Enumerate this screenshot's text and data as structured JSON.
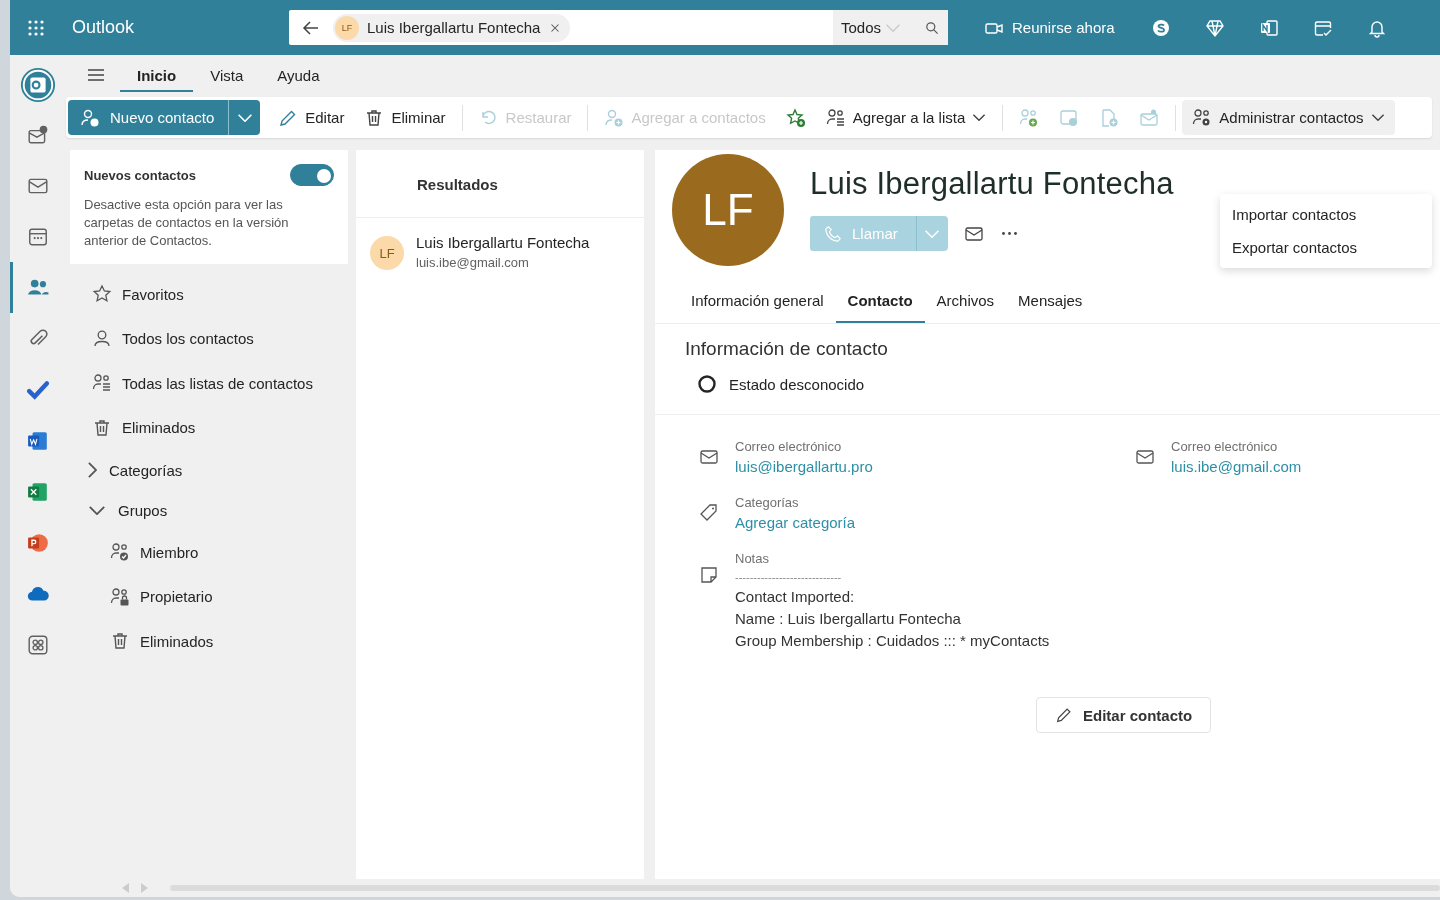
{
  "app": {
    "title": "Outlook"
  },
  "search": {
    "chip": {
      "initials": "LF",
      "label": "Luis Ibergallartu Fontecha"
    },
    "scope": "Todos"
  },
  "header_actions": [
    {
      "kind": "video",
      "label": "Reunirse ahora"
    },
    {
      "kind": "skype"
    },
    {
      "kind": "diamond"
    },
    {
      "kind": "onenote"
    },
    {
      "kind": "calendar-check"
    },
    {
      "kind": "bell"
    }
  ],
  "rail": [
    {
      "kind": "outlook",
      "selected": false
    },
    {
      "kind": "mail-add",
      "selected": false
    },
    {
      "kind": "mail",
      "selected": false
    },
    {
      "kind": "calendar",
      "selected": false
    },
    {
      "kind": "people",
      "selected": true
    },
    {
      "kind": "attach",
      "selected": false
    },
    {
      "kind": "todo",
      "selected": false
    },
    {
      "kind": "word",
      "selected": false
    },
    {
      "kind": "excel",
      "selected": false
    },
    {
      "kind": "powerpoint",
      "selected": false
    },
    {
      "kind": "onedrive",
      "selected": false
    },
    {
      "kind": "apps",
      "selected": false
    }
  ],
  "ribbon_tabs": [
    {
      "label": "Inicio",
      "selected": true
    },
    {
      "label": "Vista",
      "selected": false
    },
    {
      "label": "Ayuda",
      "selected": false
    }
  ],
  "toolbar": [
    {
      "kind": "new",
      "label": "Nuevo contacto",
      "disabled": false
    },
    {
      "kind": "edit",
      "label": "Editar",
      "disabled": false
    },
    {
      "kind": "delete",
      "label": "Eliminar",
      "disabled": false
    },
    {
      "kind": "restore",
      "label": "Restaurar",
      "disabled": true
    },
    {
      "kind": "add-contact",
      "label": "Agregar a contactos",
      "disabled": true
    },
    {
      "kind": "favorite",
      "disabled": false
    },
    {
      "kind": "add-list",
      "label": "Agregar a la lista",
      "disabled": false
    },
    {
      "kind": "add-people",
      "disabled": true
    },
    {
      "kind": "chat",
      "disabled": true
    },
    {
      "kind": "file-add",
      "disabled": true
    },
    {
      "kind": "mail-bell",
      "disabled": true
    },
    {
      "kind": "manage",
      "label": "Administrar contactos",
      "disabled": false
    }
  ],
  "manage_menu": [
    "Importar contactos",
    "Exportar contactos"
  ],
  "new_contacts_card": {
    "title": "Nuevos contactos",
    "on": true,
    "text": "Desactive esta opción para ver las carpetas de contactos en la versión anterior de Contactos."
  },
  "nav": [
    {
      "kind": "favorites",
      "label": "Favoritos"
    },
    {
      "kind": "all",
      "label": "Todos los contactos"
    },
    {
      "kind": "lists",
      "label": "Todas las listas de contactos"
    },
    {
      "kind": "deleted",
      "label": "Eliminados"
    },
    {
      "kind": "group",
      "label": "Categorías",
      "expanded": false
    },
    {
      "kind": "group",
      "label": "Grupos",
      "expanded": true,
      "children": [
        {
          "kind": "member",
          "label": "Miembro"
        },
        {
          "kind": "owner",
          "label": "Propietario"
        },
        {
          "kind": "deleted",
          "label": "Eliminados"
        }
      ]
    }
  ],
  "results": {
    "title": "Resultados",
    "items": [
      {
        "initials": "LF",
        "name": "Luis Ibergallartu Fontecha",
        "email": "luis.ibe@gmail.com"
      }
    ]
  },
  "contact": {
    "initials": "LF",
    "name": "Luis Ibergallartu Fontecha",
    "call": {
      "label": "Llamar",
      "disabled": true
    },
    "tabs": [
      {
        "label": "Información general",
        "selected": false
      },
      {
        "label": "Contacto",
        "selected": true
      },
      {
        "label": "Archivos",
        "selected": false
      },
      {
        "label": "Mensajes",
        "selected": false
      }
    ],
    "section_title": "Información de contacto",
    "presence": "Estado desconocido",
    "emails": [
      {
        "label": "Correo electrónico",
        "value": "luis@ibergallartu.pro"
      },
      {
        "label": "Correo electrónico",
        "value": "luis.ibe@gmail.com"
      }
    ],
    "categories": {
      "label": "Categorías",
      "action": "Agregar categoría"
    },
    "notes": {
      "label": "Notas",
      "lines": [
        "-----------------------------",
        "Contact Imported:",
        "Name : Luis Ibergallartu Fontecha",
        "Group Membership : Cuidados ::: * myContacts"
      ]
    },
    "edit_button": "Editar contacto"
  }
}
